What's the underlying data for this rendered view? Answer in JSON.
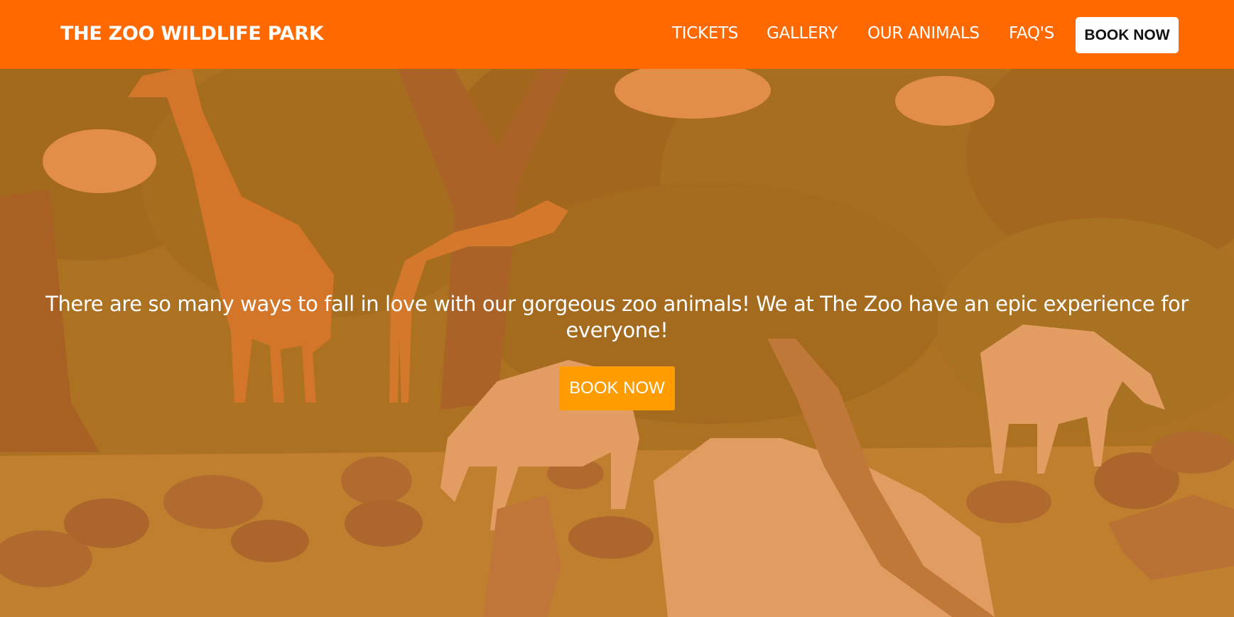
{
  "header": {
    "brand": "THE ZOO WILDLIFE PARK",
    "nav": {
      "tickets": "TICKETS",
      "gallery": "GALLERY",
      "our_animals": "OUR ANIMALS",
      "faqs": "FAQ'S"
    },
    "book_label": "BOOK NOW"
  },
  "hero": {
    "message": "There are so many ways to fall in love with our gorgeous zoo animals! We at The Zoo have an epic experience for everyone!",
    "book_label": "BOOK NOW"
  },
  "colors": {
    "navbar": "#ff6900",
    "hero_button": "#ff9c00",
    "nav_button": "#ffffff",
    "overlay_tint": "#eb7619"
  }
}
